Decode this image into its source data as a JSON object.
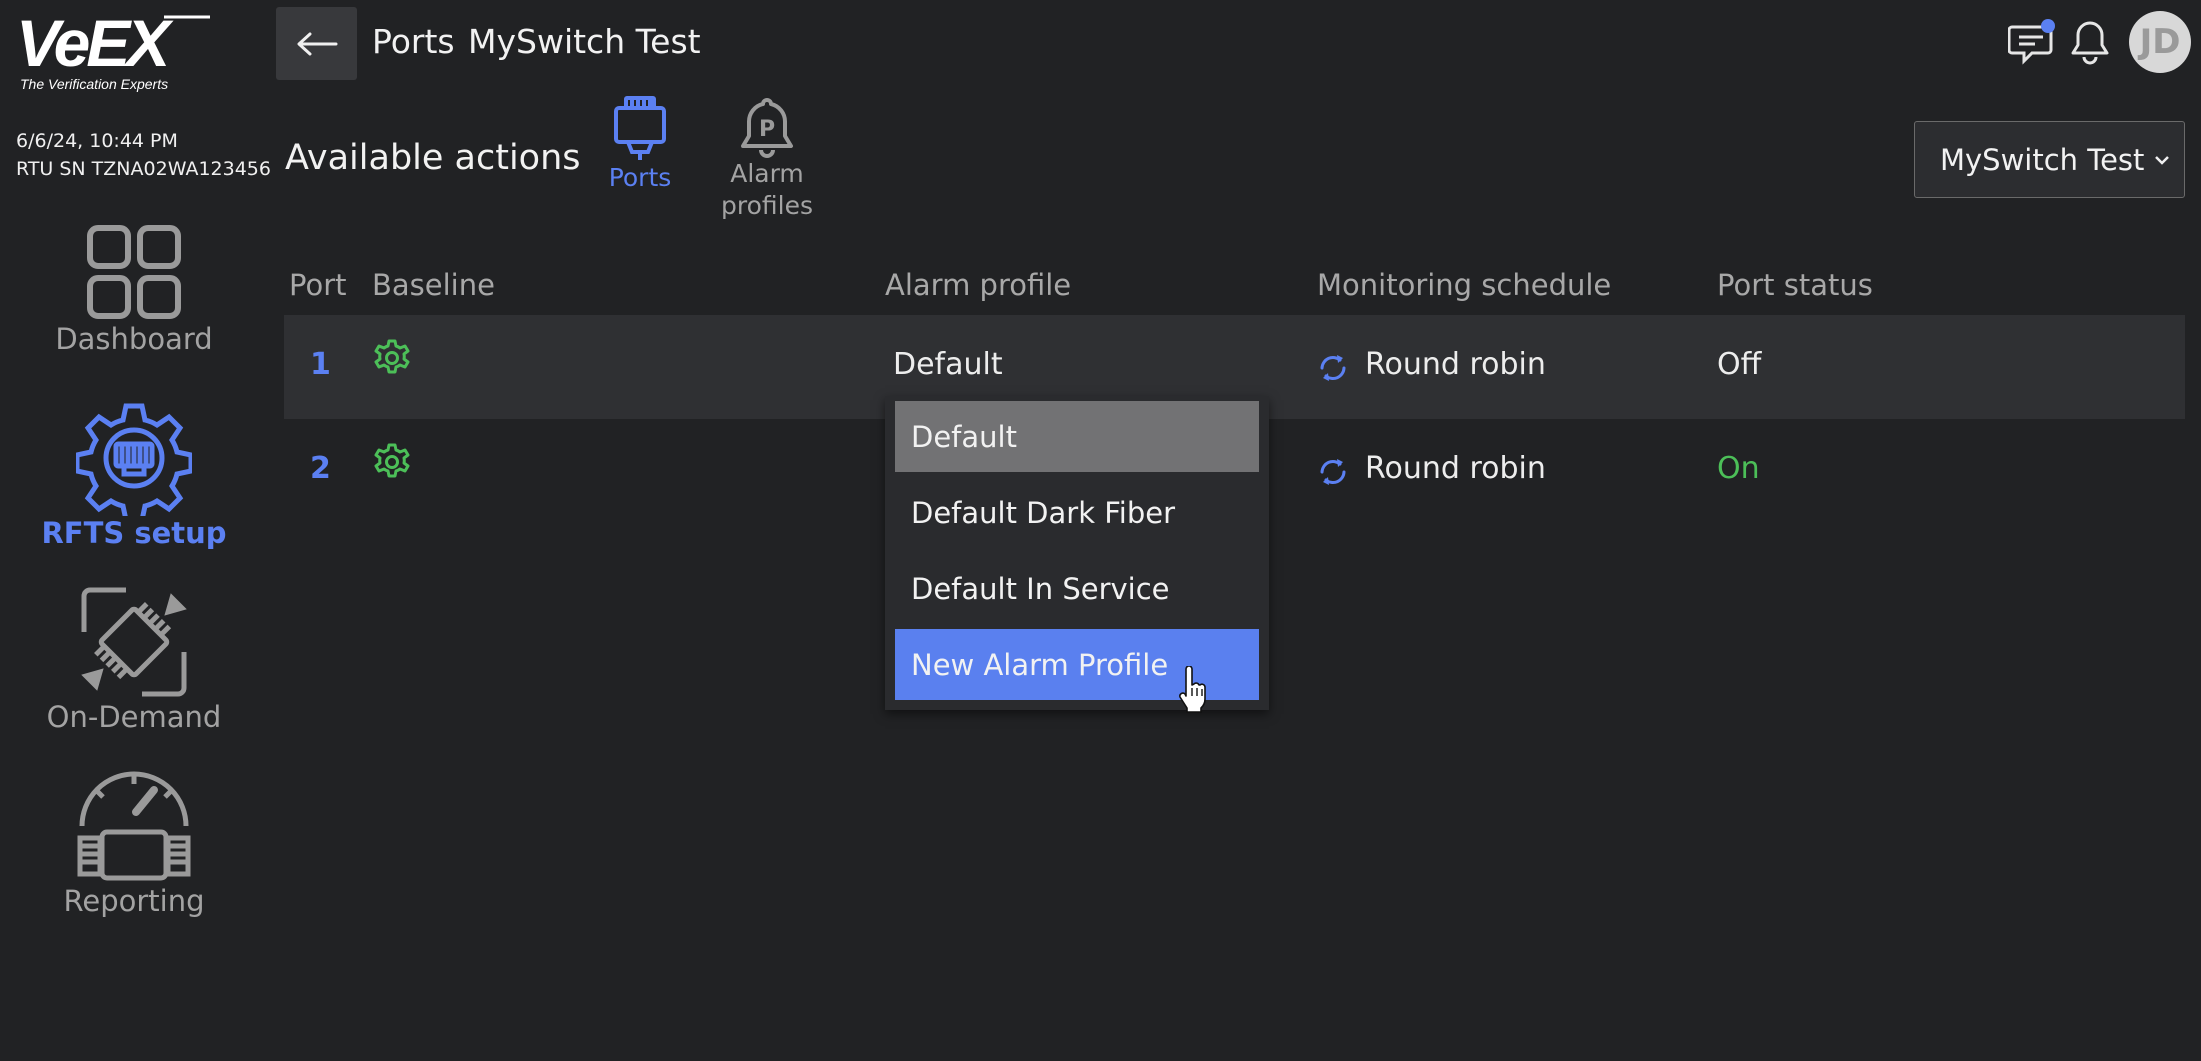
{
  "brand": {
    "logo_text": "VeEX",
    "tagline": "The Verification Experts"
  },
  "device": {
    "datetime": "6/6/24, 10:44 PM",
    "serial": "RTU SN TZNA02WA123456"
  },
  "sidebar": {
    "items": [
      {
        "label": "Dashboard",
        "icon": "dashboard-icon",
        "active": false
      },
      {
        "label": "RFTS setup",
        "icon": "rfts-setup-icon",
        "active": true
      },
      {
        "label": "On-Demand",
        "icon": "on-demand-icon",
        "active": false
      },
      {
        "label": "Reporting",
        "icon": "reporting-icon",
        "active": false
      }
    ]
  },
  "header": {
    "back_icon": "arrow-left-icon",
    "title": "Ports",
    "subtitle": "MySwitch Test",
    "avatar_initials": "JD",
    "notification_dot_color": "#5b80f2"
  },
  "actions": {
    "title": "Available actions",
    "tabs": [
      {
        "label": "Ports",
        "icon": "port-connector-icon",
        "active": true
      },
      {
        "label_line1": "Alarm",
        "label_line2": "profiles",
        "icon": "alarm-profile-bell-icon",
        "active": false
      }
    ],
    "switch_select": {
      "value": "MySwitch Test"
    }
  },
  "table": {
    "columns": [
      "Port",
      "Baseline",
      "Alarm profile",
      "Monitoring schedule",
      "Port status"
    ],
    "rows": [
      {
        "port": "1",
        "alarm_profile": "Default",
        "schedule": "Round robin",
        "status": "Off"
      },
      {
        "port": "2",
        "alarm_profile": "",
        "schedule": "Round robin",
        "status": "On"
      }
    ]
  },
  "dropdown": {
    "options": [
      "Default",
      "Default Dark Fiber",
      "Default In Service",
      "New Alarm Profile"
    ],
    "selected": "Default",
    "hovered": "New Alarm Profile"
  },
  "colors": {
    "background": "#212224",
    "accent": "#5b80f2",
    "status_on": "#4cbf58",
    "baseline_gear": "#4cbf58"
  }
}
